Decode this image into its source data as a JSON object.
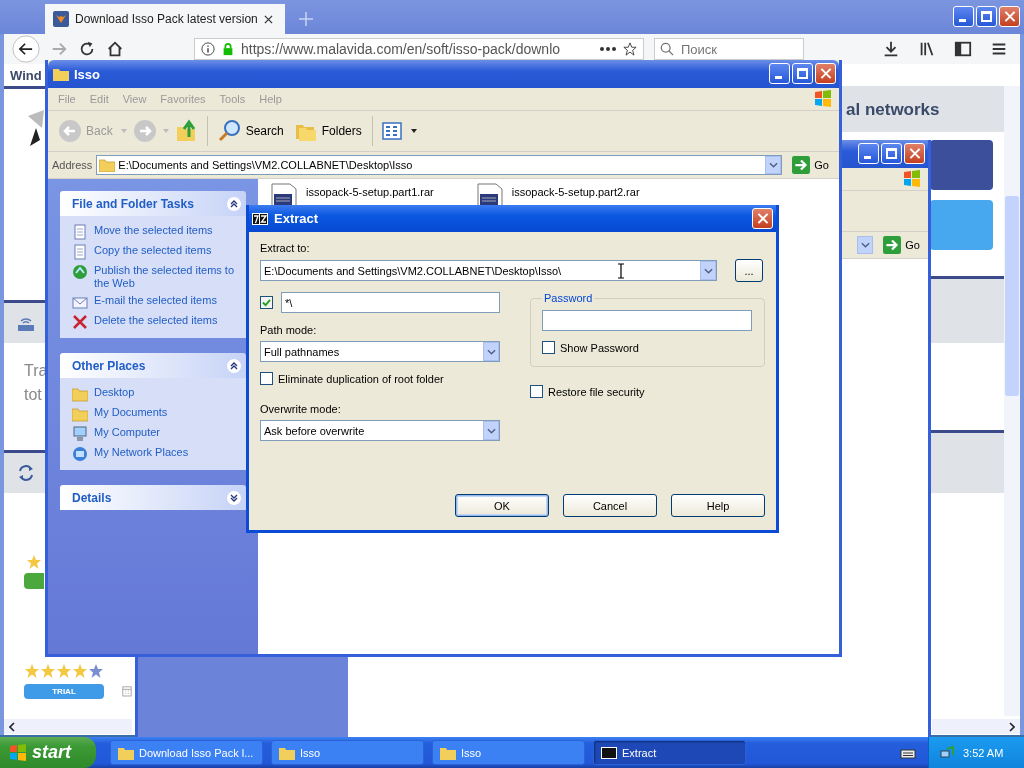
{
  "browser": {
    "tab_title": "Download Isso Pack latest version",
    "url": "https://www.malavida.com/en/soft/isso-pack/downlo",
    "search": {
      "placeholder": "Поиск"
    }
  },
  "web_page": {
    "heading_fragment": "Wind",
    "section_title": "al networks",
    "text_fragments": [
      "Tra",
      "tot"
    ],
    "rating": {
      "stars": 4
    },
    "badge": "TRIAL"
  },
  "back_window": {
    "go_button": "Go"
  },
  "explorer": {
    "title": "Isso",
    "menu": [
      "File",
      "Edit",
      "View",
      "Favorites",
      "Tools",
      "Help"
    ],
    "toolbar": {
      "back": "Back",
      "search": "Search",
      "folders": "Folders"
    },
    "address_label": "Address",
    "address": "E:\\Documents and Settings\\VM2.COLLABNET\\Desktop\\Isso",
    "go_button": "Go",
    "panels": [
      {
        "title": "File and Folder Tasks",
        "expanded": true,
        "items": [
          "Move the selected items",
          "Copy the selected items",
          "Publish the selected items to the Web",
          "E-mail the selected items",
          "Delete the selected items"
        ]
      },
      {
        "title": "Other Places",
        "expanded": true,
        "items": [
          "Desktop",
          "My Documents",
          "My Computer",
          "My Network Places"
        ]
      },
      {
        "title": "Details",
        "expanded": false
      }
    ],
    "files": [
      "issopack-5-setup.part1.rar",
      "issopack-5-setup.part2.rar"
    ]
  },
  "dialog": {
    "title": "Extract",
    "extract_to_label": "Extract to:",
    "extract_to": "E:\\Documents and Settings\\VM2.COLLABNET\\Desktop\\Isso\\",
    "browse_button": "...",
    "filter": {
      "checked": true,
      "value": "*\\"
    },
    "path_mode_label": "Path mode:",
    "path_mode": "Full pathnames",
    "eliminate_duplication": {
      "label": "Eliminate duplication of root folder",
      "checked": false
    },
    "overwrite_mode_label": "Overwrite mode:",
    "overwrite_mode": "Ask before overwrite",
    "password_group": "Password",
    "show_password": {
      "label": "Show Password",
      "checked": false
    },
    "restore_security": {
      "label": "Restore file security",
      "checked": false
    },
    "buttons": [
      {
        "label": "OK",
        "default": true
      },
      {
        "label": "Cancel",
        "default": false
      },
      {
        "label": "Help",
        "default": false
      }
    ]
  },
  "taskbar": {
    "start": "start",
    "tasks": [
      {
        "label": "Download Isso Pack l...",
        "selected": false
      },
      {
        "label": "Isso",
        "selected": false
      },
      {
        "label": "Isso",
        "selected": false
      },
      {
        "label": "Extract",
        "selected": true
      }
    ],
    "clock": "3:52 AM"
  }
}
